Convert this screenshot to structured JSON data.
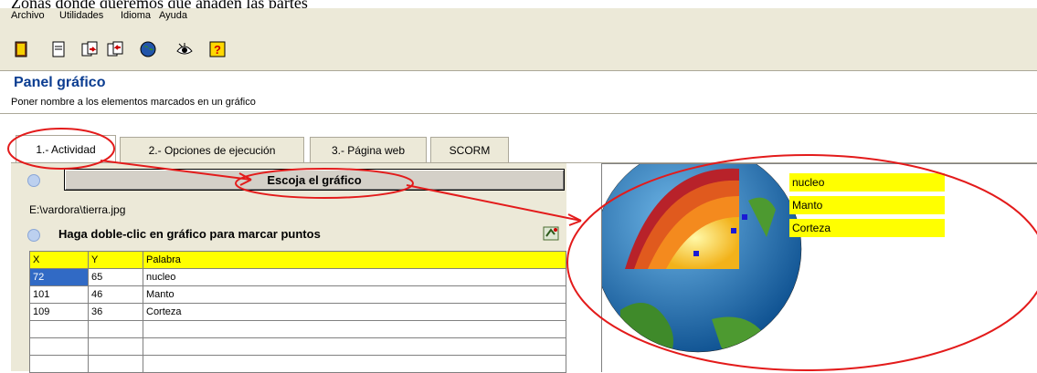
{
  "caption": "Zonas donde queremos que anaden las partes",
  "menu": [
    "Archivo",
    "Utilidades",
    "Idioma",
    "Ayuda"
  ],
  "toolbar": {
    "icons": [
      "exit-icon",
      "new-document-icon",
      "open-document-icon",
      "save-document-icon",
      "globe-icon",
      "eye-icon",
      "help-icon"
    ]
  },
  "panel": {
    "title": "Panel gráfico",
    "subtitle": "Poner nombre a los elementos marcados en un gráfico"
  },
  "tabs": [
    {
      "label": "1.- Actividad",
      "active": true
    },
    {
      "label": "2.- Opciones de ejecución",
      "active": false
    },
    {
      "label": "3.- Página web",
      "active": false
    },
    {
      "label": "SCORM",
      "active": false
    }
  ],
  "choose_button": "Escoja el gráfico",
  "image_path": "E:\\vardora\\tierra.jpg",
  "dblclick_hint": "Haga doble-clic en gráfico para marcar puntos",
  "table": {
    "headers": [
      "X",
      "Y",
      "Palabra"
    ],
    "rows": [
      [
        "72",
        "65",
        "nucleo"
      ],
      [
        "101",
        "46",
        "Manto"
      ],
      [
        "109",
        "36",
        "Corteza"
      ]
    ]
  },
  "labels": [
    "nucleo",
    "Manto",
    "Corteza"
  ],
  "colors": {
    "accent_highlight": "#ffff00",
    "title_blue": "#0b3d91",
    "annotation_red": "#e31b1b",
    "marker_blue": "#1a1ad4"
  }
}
